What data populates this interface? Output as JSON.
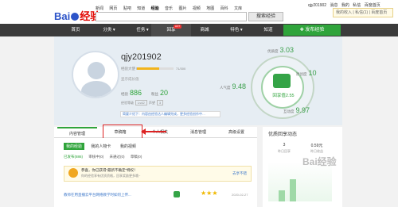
{
  "topbar": {
    "logo_left": "Bai",
    "logo_right": "经验",
    "nav": [
      "新闻",
      "网页",
      "贴吧",
      "知道",
      "经验",
      "音乐",
      "图片",
      "视频",
      "地图",
      "百科",
      "文库"
    ],
    "active_nav_index": 4,
    "search_placeholder": "",
    "search_button": "搜索经验",
    "username": "qjy201902",
    "user_links": [
      "消息",
      "我的",
      "私信",
      "百度首页"
    ],
    "notice": "我的收入 | 私信(1) | 百度首页"
  },
  "mainnav": {
    "items": [
      "首页",
      "分类 ▾",
      "任务 ▾",
      "回享",
      "商城",
      "特色 ▾",
      "知道"
    ],
    "hot_badge": "HOT",
    "publish_button": "✚ 发布经验"
  },
  "profile": {
    "name": "qjy201902",
    "level_label": "经验大使 Lv2",
    "level_progress": 0.6,
    "level_value": "71/300",
    "grow_text": "显示成长值",
    "stats": [
      {
        "label": "经验",
        "value": "886"
      },
      {
        "label": "粉丝",
        "value": "20"
      }
    ],
    "tags_label": "经验等级",
    "tags": [
      "Lv42"
    ],
    "tags_label2": "声望",
    "tags2": [
      "3"
    ],
    "intro_text": "简要介绍下：内容由经验达人编辑完成，更多经验创作中…"
  },
  "ring": {
    "score_label": "回享值2.55",
    "metrics": [
      {
        "label": "优质度",
        "value": "3.03"
      },
      {
        "label": "原创度",
        "value": "10"
      },
      {
        "label": "人气度",
        "value": "9.48"
      },
      {
        "label": "互动度",
        "value": "9.97"
      }
    ]
  },
  "tabs": [
    "内容管理",
    "草稿箱",
    "个人相关",
    "消息管理",
    "高级设置"
  ],
  "active_tab_index": 0,
  "subtabs": [
    "我的经验",
    "我的人物卡",
    "我的视频"
  ],
  "filter": [
    "已发布(886)",
    "审核中(0)",
    "未通过(0)",
    "草稿(0)"
  ],
  "tip": {
    "title": "恭喜，你已获得“最新不确定”特权！",
    "subtitle": "你的经验享有优质资格，回享奖励更多哦~",
    "link": "去享不错"
  },
  "row": {
    "title": "教师在用直播云平台网络教学时如何上传...",
    "stars": "★★★",
    "date": "2020-02-27"
  },
  "side": {
    "title": "优质回享动态",
    "stats": [
      {
        "value": "3",
        "sub": "昨日回享"
      },
      {
        "value": "0.59元",
        "sub": "昨日收益"
      }
    ],
    "bar_values": [
      0.3,
      0.6
    ]
  },
  "watermark": "Bai经验"
}
